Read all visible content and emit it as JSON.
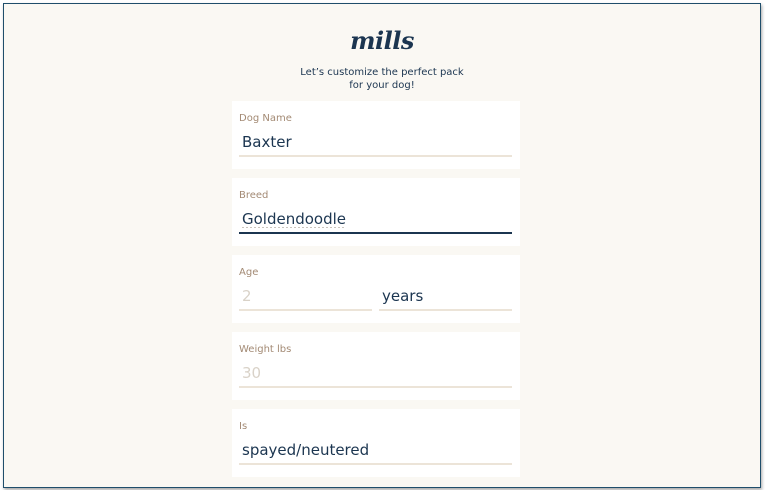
{
  "brand": {
    "logo_text": "mills"
  },
  "intro": {
    "line1": "Let’s customize the perfect pack",
    "line2": "for your dog!"
  },
  "form": {
    "dog_name": {
      "label": "Dog Name",
      "value": "Baxter"
    },
    "breed": {
      "label": "Breed",
      "value": "Goldendoodle"
    },
    "age": {
      "label": "Age",
      "placeholder": "2",
      "unit_value": "years"
    },
    "weight": {
      "label": "Weight lbs",
      "placeholder": "30"
    },
    "status": {
      "label": "Is",
      "value": "spayed/neutered"
    }
  },
  "colors": {
    "brand_navy": "#1b3550",
    "label_tan": "#a38a74",
    "background_cream": "#faf8f3",
    "underline_beige": "#ece4d8"
  }
}
